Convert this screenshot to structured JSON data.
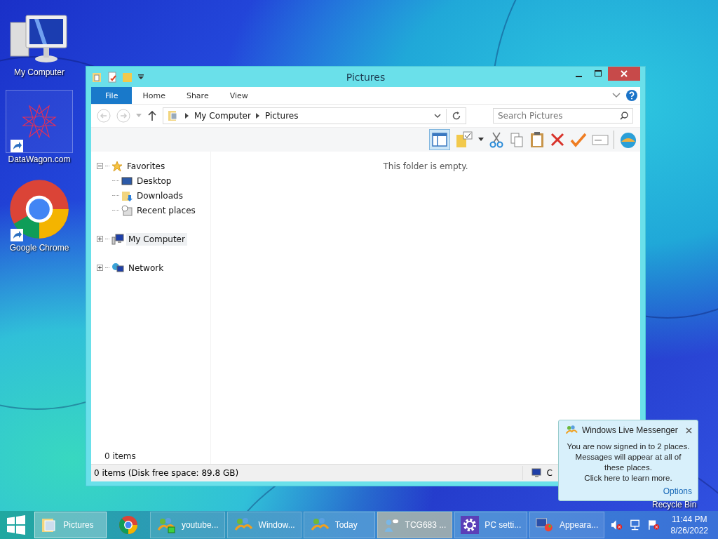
{
  "desktop_icons": [
    {
      "label": "My Computer",
      "kind": "computer"
    },
    {
      "label": "DataWagon.com",
      "kind": "star-logo"
    },
    {
      "label": "Google Chrome",
      "kind": "chrome"
    }
  ],
  "window": {
    "title": "Pictures",
    "ribbon_tabs": [
      {
        "label": "File",
        "kind": "file",
        "selected": false
      },
      {
        "label": "Home",
        "kind": "tab",
        "selected": false
      },
      {
        "label": "Share",
        "kind": "tab",
        "selected": false
      },
      {
        "label": "View",
        "kind": "tab",
        "selected": false
      }
    ],
    "address": {
      "segments": [
        "My Computer",
        "Pictures"
      ]
    },
    "search": {
      "placeholder": "Search Pictures"
    },
    "nav_tree": [
      {
        "label": "Favorites",
        "kind": "star",
        "expanded": true,
        "selected": false,
        "children": [
          {
            "label": "Desktop",
            "kind": "desktop"
          },
          {
            "label": "Downloads",
            "kind": "downloads"
          },
          {
            "label": "Recent places",
            "kind": "recent"
          }
        ]
      },
      {
        "label": "My Computer",
        "kind": "computer",
        "expanded": false,
        "selected": true
      },
      {
        "label": "Network",
        "kind": "network",
        "expanded": false,
        "selected": false
      }
    ],
    "empty_message": "This folder is empty.",
    "item_count": "0 items",
    "status_bar": {
      "text": "0 items (Disk free space: 89.8 GB)",
      "right_label": "C"
    }
  },
  "notification": {
    "title": "Windows Live Messenger",
    "message": "You are now signed in to 2 places. Messages will appear at all of these places.",
    "link": "Click here to learn more.",
    "options": "Options"
  },
  "recycle_bin_label": "Recycle Bin",
  "taskbar": {
    "items": [
      {
        "label": "Pictures",
        "kind": "folder",
        "active": true,
        "flashing": false
      },
      {
        "kind": "chrome",
        "active": false,
        "flashing": false
      },
      {
        "label": "youtube...",
        "kind": "messenger-status",
        "active": false,
        "flashing": false
      },
      {
        "label": "Window...",
        "kind": "messenger",
        "active": false,
        "flashing": false
      },
      {
        "label": "Today",
        "kind": "messenger",
        "active": false,
        "flashing": false
      },
      {
        "label": "TCG683 ...",
        "kind": "chat",
        "active": false,
        "flashing": true
      },
      {
        "label": "PC setti...",
        "kind": "gear",
        "active": false,
        "flashing": false
      },
      {
        "label": "Appeara...",
        "kind": "appearance",
        "active": false,
        "flashing": false
      }
    ],
    "time": "11:44 PM",
    "date": "8/26/2022"
  }
}
